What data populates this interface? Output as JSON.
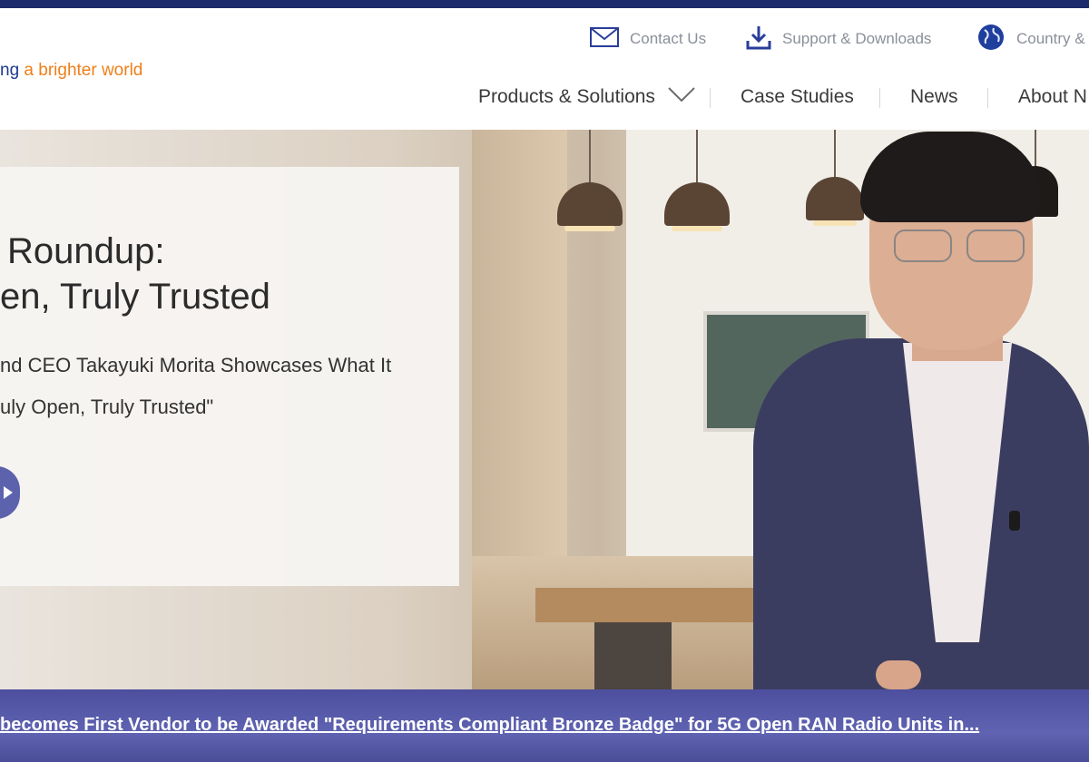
{
  "header": {
    "tagline_part1": "ng",
    "tagline_part2": " a brighter world",
    "utility": {
      "contact": "Contact Us",
      "support": "Support & Downloads",
      "country": "Country &"
    },
    "nav": {
      "products": "Products & Solutions",
      "case_studies": "Case Studies",
      "news": "News",
      "about": "About N"
    }
  },
  "hero": {
    "title_line1": "Roundup:",
    "title_line2": "en, Truly Trusted",
    "desc_line1": "nd CEO Takayuki Morita Showcases What It",
    "desc_line2": "uly Open, Truly Trusted\""
  },
  "news_bar": {
    "headline": "becomes First Vendor to be Awarded \"Requirements Compliant Bronze Badge\" for 5G Open RAN Radio Units in..."
  },
  "colors": {
    "brand_navy": "#1d2a6b",
    "tagline_blue": "#1d3b8f",
    "tagline_orange": "#ef7f1a",
    "news_bar": "#5f63b2",
    "play_button": "#5d62ad"
  }
}
